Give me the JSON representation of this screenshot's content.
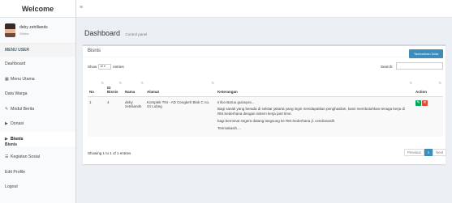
{
  "brand": "Welcome",
  "user": {
    "name": "deby zetriliands",
    "status": "Online"
  },
  "menu": {
    "header": "MENU USER",
    "items": [
      {
        "icon": "",
        "label": "Dashboard"
      },
      {
        "icon": "▦",
        "label": "Menu Utama"
      },
      {
        "icon": "",
        "label": "Data Warga"
      },
      {
        "icon": "✎",
        "label": "Modul Berita"
      },
      {
        "icon": "▶",
        "label": "Donasi"
      },
      {
        "icon": "▶",
        "label": "Bisnis"
      },
      {
        "icon": "☰",
        "label": "Kegiatan Sosial"
      },
      {
        "icon": "",
        "label": "Edit Profile"
      },
      {
        "icon": "",
        "label": "Logout"
      }
    ],
    "active_sub": "Bisnis"
  },
  "page": {
    "title": "Dashboard",
    "subtitle": "Control panel"
  },
  "box": {
    "title": "Bisnis",
    "add_label": "Tambahkan Data",
    "show_label": "Show",
    "entries_value": "10",
    "entries_label": "entries",
    "search_label": "Search:"
  },
  "table": {
    "headers": {
      "no": "No",
      "id": "ID Bisnis",
      "nama": "Nama",
      "alamat": "Alamat",
      "keterangan": "Keterangan",
      "action": "Action"
    },
    "rows": [
      {
        "no": "1",
        "id": "4",
        "nama": "deby zetriliands",
        "alamat": "Komplek TNI - AD Cengkeh Blok C no. 44 Lubeg",
        "keterangan": [
          "Infoo Baruu guissyss...",
          "Bagi sanak yang berada di sekitar jakarta yang ingin mendapatkan penghasilan, kami membutuhkan tenaga kerja di RM.Sederhana dengan sistem kerja part time.",
          "bagi berminat segera datang langsung ke RM.Sederhana jl. cendravasih",
          "Terimakasih...."
        ]
      }
    ]
  },
  "footer": {
    "showing": "Showing 1 to 1 of 1 entries",
    "previous": "Previous",
    "page": "1",
    "next": "Next"
  }
}
